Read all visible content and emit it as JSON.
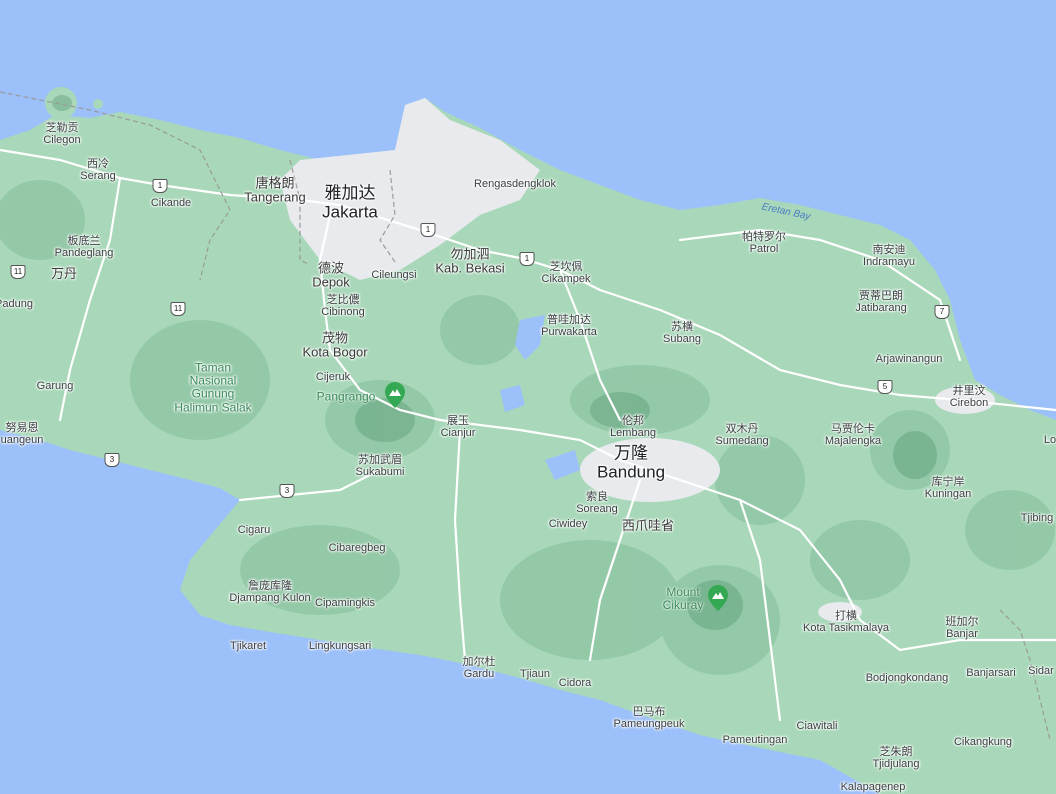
{
  "places": [
    {
      "id": "cilegon",
      "zh": "芝勒贡",
      "en": "Cilegon",
      "size": "sm"
    },
    {
      "id": "serang",
      "zh": "西冷",
      "en": "Serang",
      "size": "sm"
    },
    {
      "id": "cikande",
      "zh": "",
      "en": "Cikande",
      "size": "sm"
    },
    {
      "id": "pandeglang",
      "zh": "板底兰",
      "en": "Pandeglang",
      "size": "sm"
    },
    {
      "id": "banten",
      "zh": "万丹",
      "en": "",
      "size": "md"
    },
    {
      "id": "labuan",
      "zh": "",
      "en": "Padung",
      "size": "sm"
    },
    {
      "id": "tangerang",
      "zh": "唐格朗",
      "en": "Tangerang",
      "size": "md"
    },
    {
      "id": "jakarta",
      "zh": "雅加达",
      "en": "Jakarta",
      "size": "lg"
    },
    {
      "id": "depok",
      "zh": "德波",
      "en": "Depok",
      "size": "md"
    },
    {
      "id": "cileungsi",
      "zh": "",
      "en": "Cileungsi",
      "size": "sm"
    },
    {
      "id": "bekasi",
      "zh": "勿加泗",
      "en": "Kab. Bekasi",
      "size": "md"
    },
    {
      "id": "rengasdengklok",
      "zh": "",
      "en": "Rengasdengklok",
      "size": "sm"
    },
    {
      "id": "cibinong",
      "zh": "芝比儂",
      "en": "Cibinong",
      "size": "sm"
    },
    {
      "id": "bogor",
      "zh": "茂物",
      "en": "Kota Bogor",
      "size": "md"
    },
    {
      "id": "cijeruk",
      "zh": "",
      "en": "Cijeruk",
      "size": "sm"
    },
    {
      "id": "garung",
      "zh": "",
      "en": "Garung",
      "size": "sm"
    },
    {
      "id": "cikampek",
      "zh": "芝坎佩",
      "en": "Cikampek",
      "size": "sm"
    },
    {
      "id": "purwakarta",
      "zh": "普哇加达",
      "en": "Purwakarta",
      "size": "sm"
    },
    {
      "id": "patrol",
      "zh": "帕特罗尔",
      "en": "Patrol",
      "size": "sm"
    },
    {
      "id": "indramayu",
      "zh": "南安迪",
      "en": "Indramayu",
      "size": "sm"
    },
    {
      "id": "jatibarang",
      "zh": "贾蒂巴朗",
      "en": "Jatibarang",
      "size": "sm"
    },
    {
      "id": "subang",
      "zh": "苏横",
      "en": "Subang",
      "size": "sm"
    },
    {
      "id": "arjawinangun",
      "zh": "",
      "en": "Arjawinangun",
      "size": "sm"
    },
    {
      "id": "cirebon",
      "zh": "井里汶",
      "en": "Cirebon",
      "size": "sm"
    },
    {
      "id": "cianjur",
      "zh": "展玉",
      "en": "Cianjur",
      "size": "sm"
    },
    {
      "id": "lembang",
      "zh": "伦邦",
      "en": "Lembang",
      "size": "sm"
    },
    {
      "id": "sumedang",
      "zh": "双木丹",
      "en": "Sumedang",
      "size": "sm"
    },
    {
      "id": "majalengka",
      "zh": "马贾伦卡",
      "en": "Majalengka",
      "size": "sm"
    },
    {
      "id": "bandung",
      "zh": "万隆",
      "en": "Bandung",
      "size": "lg"
    },
    {
      "id": "sukabumi",
      "zh": "苏加武眉",
      "en": "Sukabumi",
      "size": "sm"
    },
    {
      "id": "kuningan",
      "zh": "库宁岸",
      "en": "Kuningan",
      "size": "sm"
    },
    {
      "id": "soreang",
      "zh": "索良",
      "en": "Soreang",
      "size": "sm"
    },
    {
      "id": "westjava",
      "zh": "西爪哇省",
      "en": "",
      "size": "md"
    },
    {
      "id": "ciwidey",
      "zh": "",
      "en": "Ciwidey",
      "size": "sm"
    },
    {
      "id": "cigaru",
      "zh": "",
      "en": "Cigaru",
      "size": "sm"
    },
    {
      "id": "cibaregbeg",
      "zh": "",
      "en": "Cibaregbeg",
      "size": "sm"
    },
    {
      "id": "djampang",
      "zh": "詹庞库隆",
      "en": "Djampang Kulon",
      "size": "sm"
    },
    {
      "id": "cipamingkis",
      "zh": "",
      "en": "Cipamingkis",
      "size": "sm"
    },
    {
      "id": "tjikaret",
      "zh": "",
      "en": "Tjikaret",
      "size": "sm"
    },
    {
      "id": "lingkungsari",
      "zh": "",
      "en": "Lingkungsari",
      "size": "sm"
    },
    {
      "id": "gardu",
      "zh": "加尔杜",
      "en": "Gardu",
      "size": "sm"
    },
    {
      "id": "tjiaun",
      "zh": "",
      "en": "Tjiaun",
      "size": "sm"
    },
    {
      "id": "cidora",
      "zh": "",
      "en": "Cidora",
      "size": "sm"
    },
    {
      "id": "pameungpeuk",
      "zh": "巴马布",
      "en": "Pameungpeuk",
      "size": "sm"
    },
    {
      "id": "pameutingan",
      "zh": "",
      "en": "Pameutingan",
      "size": "sm"
    },
    {
      "id": "ciawitali",
      "zh": "",
      "en": "Ciawitali",
      "size": "sm"
    },
    {
      "id": "tasikmalaya",
      "zh": "打横",
      "en": "Kota Tasikmalaya",
      "size": "sm"
    },
    {
      "id": "banjar",
      "zh": "班加尔",
      "en": "Banjar",
      "size": "sm"
    },
    {
      "id": "banjarsari",
      "zh": "",
      "en": "Banjarsari",
      "size": "sm"
    },
    {
      "id": "bodjongkondang",
      "zh": "",
      "en": "Bodjongkondang",
      "size": "sm"
    },
    {
      "id": "cikangkung",
      "zh": "",
      "en": "Cikangkung",
      "size": "sm"
    },
    {
      "id": "tjidjulang",
      "zh": "芝朱朗",
      "en": "Tjidjulang",
      "size": "sm"
    },
    {
      "id": "kalapagenep",
      "zh": "",
      "en": "Kalapagenep",
      "size": "sm"
    },
    {
      "id": "tjibing",
      "zh": "",
      "en": "Tjibing",
      "size": "sm"
    },
    {
      "id": "sidar",
      "zh": "",
      "en": "Sidar",
      "size": "sm"
    },
    {
      "id": "lo",
      "zh": "",
      "en": "Lo",
      "size": "sm"
    },
    {
      "id": "krangeun",
      "zh": "努易恩",
      "en": "uangeun",
      "size": "sm"
    }
  ],
  "park": {
    "lines": [
      "Taman",
      "Nasional",
      "Gunung",
      "Halimun Salak"
    ]
  },
  "water": {
    "label": "Eretan Bay"
  },
  "peaks": [
    {
      "id": "pangrango",
      "label": "Pangrango",
      "lines": [
        "Pangrango"
      ]
    },
    {
      "id": "cikuray",
      "label": "Mount Cikuray",
      "lines": [
        "Mount",
        "Cikuray"
      ]
    }
  ],
  "shields": [
    {
      "id": "s1",
      "num": "1"
    },
    {
      "id": "s2",
      "num": "11"
    },
    {
      "id": "s3",
      "num": "11"
    },
    {
      "id": "s4",
      "num": "1"
    },
    {
      "id": "s5",
      "num": "1"
    },
    {
      "id": "s6",
      "num": "3"
    },
    {
      "id": "s7",
      "num": "3"
    },
    {
      "id": "s8",
      "num": "5"
    },
    {
      "id": "s9",
      "num": "7"
    }
  ],
  "colors": {
    "sea": "#9cc0f9",
    "land": "#a8d8b9",
    "urban": "#e8eaed",
    "road": "#ffffff",
    "border": "#9a9a9a",
    "terrain": "#6fae8a"
  }
}
